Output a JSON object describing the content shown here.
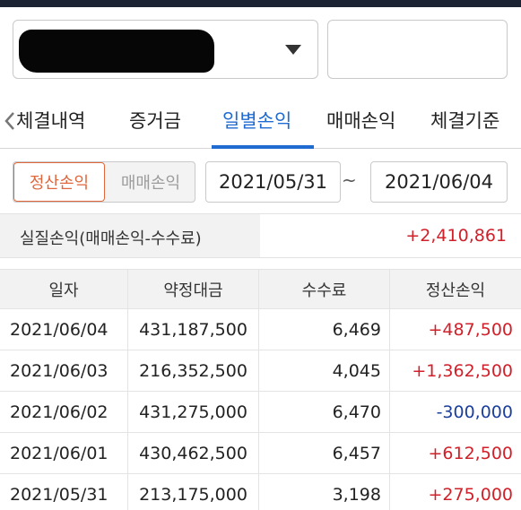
{
  "header": {
    "account_select": {
      "value_redacted": true
    },
    "password_field": {
      "value": ""
    }
  },
  "tabs": [
    {
      "label": "체결내역",
      "active": false
    },
    {
      "label": "증거금",
      "active": false
    },
    {
      "label": "일별손익",
      "active": true
    },
    {
      "label": "매매손익",
      "active": false
    },
    {
      "label": "체결기준",
      "active": false
    }
  ],
  "filters": {
    "mode_selected": "정산손익",
    "mode_unselected": "매매손익",
    "date_from": "2021/05/31",
    "date_separator": "~",
    "date_to": "2021/06/04"
  },
  "summary": {
    "label": "실질손익(매매손익-수수료)",
    "value": "+2,410,861"
  },
  "table": {
    "columns": [
      "일자",
      "약정대금",
      "수수료",
      "정산손익"
    ],
    "rows": [
      {
        "date": "2021/06/04",
        "amount": "431,187,500",
        "fee": "6,469",
        "pnl": "+487,500"
      },
      {
        "date": "2021/06/03",
        "amount": "216,352,500",
        "fee": "4,045",
        "pnl": "+1,362,500"
      },
      {
        "date": "2021/06/02",
        "amount": "431,275,000",
        "fee": "6,470",
        "pnl": "-300,000"
      },
      {
        "date": "2021/06/01",
        "amount": "430,462,500",
        "fee": "6,457",
        "pnl": "+612,500"
      },
      {
        "date": "2021/05/31",
        "amount": "213,175,000",
        "fee": "3,198",
        "pnl": "+275,000"
      }
    ]
  },
  "colors": {
    "accent_blue": "#1f6bd1",
    "positive_red": "#d0202a",
    "negative_blue": "#1c3f9c",
    "selected_orange": "#e0663c"
  }
}
